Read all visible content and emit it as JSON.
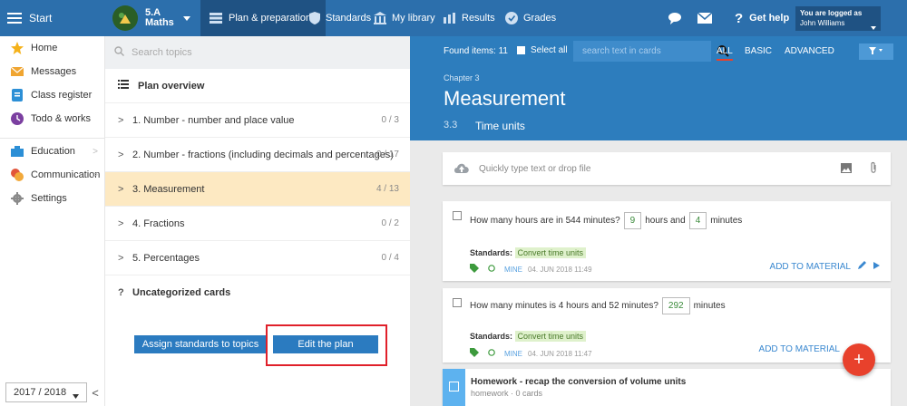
{
  "topbar": {
    "start_label": "Start",
    "class_name": "5.A",
    "subject": "Maths",
    "nav": {
      "plan": "Plan & preparations",
      "standards": "Standards",
      "library": "My library",
      "results": "Results",
      "grades": "Grades",
      "help": "Get help"
    },
    "login_line1": "You are logged as",
    "login_user": "John Williams"
  },
  "sidebar": {
    "items": [
      {
        "label": "Home",
        "icon": "star-icon"
      },
      {
        "label": "Messages",
        "icon": "envelope-icon"
      },
      {
        "label": "Class register",
        "icon": "register-icon"
      },
      {
        "label": "Todo & works",
        "icon": "todo-icon"
      },
      {
        "label": "Education",
        "icon": "education-icon"
      },
      {
        "label": "Communication",
        "icon": "communication-icon"
      },
      {
        "label": "Settings",
        "icon": "gear-icon"
      }
    ],
    "year": "2017 / 2018"
  },
  "topics": {
    "search_placeholder": "Search topics",
    "overview_label": "Plan overview",
    "items": [
      {
        "label": "1. Number - number and place value",
        "count": "0 / 3"
      },
      {
        "label": "2. Number - fractions (including decimals and percentages)",
        "count": "0 / 17"
      },
      {
        "label": "3. Measurement",
        "count": "4 / 13"
      },
      {
        "label": "4. Fractions",
        "count": "0 / 2"
      },
      {
        "label": "5. Percentages",
        "count": "0 / 4"
      }
    ],
    "uncategorized_label": "Uncategorized cards",
    "uncategorized_mark": "?",
    "assign_button": "Assign standards to topics",
    "edit_button": "Edit the plan"
  },
  "main": {
    "found_label": "Found items: 11",
    "select_all": "Select all",
    "search_placeholder": "search text in cards",
    "filters": {
      "all": "ALL",
      "basic": "BASIC",
      "advanced": "ADVANCED"
    },
    "chapter": "Chapter 3",
    "title": "Measurement",
    "section_num": "3.3",
    "section_title": "Time units",
    "type_placeholder": "Quickly type text or drop file",
    "cards": [
      {
        "q_prefix": "How many hours are in 544 minutes?",
        "ans1": "9",
        "q_mid": "hours and",
        "ans2": "4",
        "q_suffix": "minutes",
        "standards_label": "Standards:",
        "standard": "Convert time units",
        "owner": "MINE",
        "date": "04. JUN 2018 11:49",
        "action": "ADD TO MATERIAL"
      },
      {
        "q_prefix": "How many minutes is 4 hours and 52 minutes?",
        "ans1": "292",
        "q_suffix": "minutes",
        "standards_label": "Standards:",
        "standard": "Convert time units",
        "owner": "MINE",
        "date": "04. JUN 2018 11:47",
        "action": "ADD TO MATERIAL"
      }
    ],
    "homework": {
      "title": "Homework - recap the conversion of volume units",
      "sub": "homework · 0 cards"
    },
    "fab": "+"
  },
  "colors": {
    "topbar": "#2c6fac",
    "header": "#2d7dbd",
    "selected_topic": "#fde9c2",
    "accent_red": "#e8412c",
    "highlight": "#e0202a"
  }
}
